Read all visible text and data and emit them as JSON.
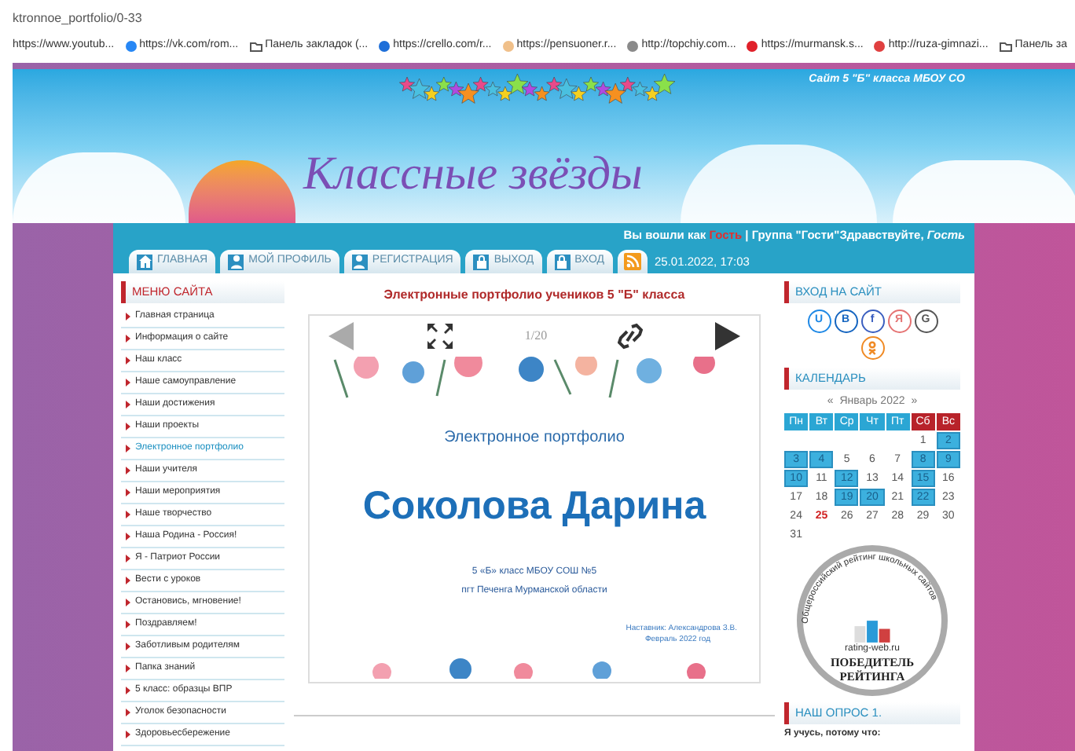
{
  "address": "ktronnoe_portfolio/0-33",
  "bookmarks": [
    {
      "kind": "plain",
      "label": "https://www.youtub..."
    },
    {
      "kind": "site",
      "color": "#2787f5",
      "label": "https://vk.com/rom..."
    },
    {
      "kind": "folder",
      "label": "Панель закладок (..."
    },
    {
      "kind": "site",
      "color": "#1e6fd9",
      "label": "https://crello.com/r..."
    },
    {
      "kind": "site",
      "color": "#f0c08a",
      "label": "https://pensuoner.r..."
    },
    {
      "kind": "site",
      "color": "#8a8a8a",
      "label": "http://topchiy.com..."
    },
    {
      "kind": "site",
      "color": "#e0202a",
      "label": "https://murmansk.s..."
    },
    {
      "kind": "site",
      "color": "#e04040",
      "label": "http://ruza-gimnazi..."
    },
    {
      "kind": "folder",
      "label": "Панель за"
    }
  ],
  "banner": {
    "caption": "Сайт 5 \"Б\" класса МБОУ СО",
    "title": "Классные звёзды"
  },
  "user_status": [
    {
      "kind": "normal",
      "text": "Вы вошли как "
    },
    {
      "kind": "highlight",
      "text": "Гость"
    },
    {
      "kind": "normal",
      "text": " | Группа \"Гости\"Здравствуйте, "
    },
    {
      "kind": "italic",
      "text": "Гость"
    }
  ],
  "tabs": [
    {
      "kind": "home",
      "label": "ГЛАВНАЯ",
      "selected": false
    },
    {
      "kind": "user",
      "label": "МОЙ ПРОФИЛЬ",
      "selected": false
    },
    {
      "kind": "user",
      "label": "РЕГИСТРАЦИЯ",
      "selected": false
    },
    {
      "kind": "lock",
      "label": "ВЫХОД",
      "selected": false
    },
    {
      "kind": "lock",
      "label": "ВХОД",
      "selected": false
    },
    {
      "kind": "rss",
      "selected": false
    }
  ],
  "datetime": "25.01.2022, 17:03",
  "menu": {
    "title": "МЕНЮ САЙТА",
    "items": [
      {
        "label": "Главная страница",
        "selected": false
      },
      {
        "label": "Информация о сайте",
        "selected": false
      },
      {
        "label": "Наш класс",
        "selected": false
      },
      {
        "label": "Наше самоуправление",
        "selected": false
      },
      {
        "label": "Наши достижения",
        "selected": false
      },
      {
        "label": "Наши проекты",
        "selected": false
      },
      {
        "label": "Электронное портфолио",
        "selected": true
      },
      {
        "label": "Наши учителя",
        "selected": false
      },
      {
        "label": "Наши мероприятия",
        "selected": false
      },
      {
        "label": "Наше творчество",
        "selected": false
      },
      {
        "label": "Наша Родина - Россия!",
        "selected": false
      },
      {
        "label": "Я - Патриот России",
        "selected": false
      },
      {
        "label": "Вести с уроков",
        "selected": false
      },
      {
        "label": "Остановись, мгновение!",
        "selected": false
      },
      {
        "label": "Поздравляем!",
        "selected": false
      },
      {
        "label": "Заботливым родителям",
        "selected": false
      },
      {
        "label": "Папка знаний",
        "selected": false
      },
      {
        "label": "5 класс: образцы ВПР",
        "selected": false
      },
      {
        "label": "Уголок безопасности",
        "selected": false
      },
      {
        "label": "Здоровьесбережение",
        "selected": false
      }
    ]
  },
  "content": {
    "heading": "Электронные портфолио учеников 5 \"Б\" класса",
    "viewer": {
      "counter": "1/20",
      "slide": {
        "subtitle": "Электронное портфолио",
        "name": "Соколова Дарина",
        "line_1": "5 «Б» класс МБОУ СОШ №5",
        "line_2": "пгт Печенга Мурманской области",
        "footer_1": "Наставник: Александрова З.В.",
        "footer_2": "Февраль 2022 год"
      }
    }
  },
  "login": {
    "title": "ВХОД НА САЙТ",
    "providers": [
      {
        "kind": "letter",
        "label": "U",
        "color": "#1e88e5"
      },
      {
        "kind": "letter",
        "label": "B",
        "color": "#1565c0"
      },
      {
        "kind": "letter",
        "label": "f",
        "color": "#3b5fc0"
      },
      {
        "kind": "letter",
        "label": "Я",
        "color": "#e57373"
      },
      {
        "kind": "letter",
        "label": "G",
        "color": "#555555"
      },
      {
        "kind": "ok",
        "color": "#f08a24"
      }
    ]
  },
  "calendar": {
    "title": "КАЛЕНДАРЬ",
    "prev": "«",
    "month": "Январь 2022",
    "next": "»",
    "weekdays": [
      {
        "label": "Пн",
        "weekend": false
      },
      {
        "label": "Вт",
        "weekend": false
      },
      {
        "label": "Ср",
        "weekend": false
      },
      {
        "label": "Чт",
        "weekend": false
      },
      {
        "label": "Пт",
        "weekend": false
      },
      {
        "label": "Сб",
        "weekend": true
      },
      {
        "label": "Вс",
        "weekend": true
      }
    ],
    "weeks": [
      {
        "right_aligned": true,
        "days": [
          {
            "day": "1",
            "linked": false,
            "today": false
          },
          {
            "day": "2",
            "linked": true,
            "today": false
          }
        ]
      },
      {
        "right_aligned": false,
        "days": [
          {
            "day": "3",
            "linked": true,
            "today": false
          },
          {
            "day": "4",
            "linked": true,
            "today": false
          },
          {
            "day": "5",
            "linked": false,
            "today": false
          },
          {
            "day": "6",
            "linked": false,
            "today": false
          },
          {
            "day": "7",
            "linked": false,
            "today": false
          },
          {
            "day": "8",
            "linked": true,
            "today": false
          },
          {
            "day": "9",
            "linked": true,
            "today": false
          }
        ]
      },
      {
        "right_aligned": false,
        "days": [
          {
            "day": "10",
            "linked": true,
            "today": false
          },
          {
            "day": "11",
            "linked": false,
            "today": false
          },
          {
            "day": "12",
            "linked": true,
            "today": false
          },
          {
            "day": "13",
            "linked": false,
            "today": false
          },
          {
            "day": "14",
            "linked": false,
            "today": false
          },
          {
            "day": "15",
            "linked": true,
            "today": false
          },
          {
            "day": "16",
            "linked": false,
            "today": false
          }
        ]
      },
      {
        "right_aligned": false,
        "days": [
          {
            "day": "17",
            "linked": false,
            "today": false
          },
          {
            "day": "18",
            "linked": false,
            "today": false
          },
          {
            "day": "19",
            "linked": true,
            "today": false
          },
          {
            "day": "20",
            "linked": true,
            "today": false
          },
          {
            "day": "21",
            "linked": false,
            "today": false
          },
          {
            "day": "22",
            "linked": true,
            "today": false
          },
          {
            "day": "23",
            "linked": false,
            "today": false
          }
        ]
      },
      {
        "right_aligned": false,
        "days": [
          {
            "day": "24",
            "linked": false,
            "today": false
          },
          {
            "day": "25",
            "linked": false,
            "today": true
          },
          {
            "day": "26",
            "linked": false,
            "today": false
          },
          {
            "day": "27",
            "linked": false,
            "today": false
          },
          {
            "day": "28",
            "linked": false,
            "today": false
          },
          {
            "day": "29",
            "linked": false,
            "today": false
          },
          {
            "day": "30",
            "linked": false,
            "today": false
          }
        ]
      },
      {
        "right_aligned": false,
        "days": [
          {
            "day": "31",
            "linked": false,
            "today": false
          }
        ]
      }
    ]
  },
  "rating_badge": {
    "arc_text": "Общероссийский рейтинг школьных сайтов",
    "site": "rating-web.ru",
    "line_1": "ПОБЕДИТЕЛЬ",
    "line_2": "РЕЙТИНГА"
  },
  "poll": {
    "title": "НАШ ОПРОС 1.",
    "question": "Я учусь, потому что:"
  }
}
